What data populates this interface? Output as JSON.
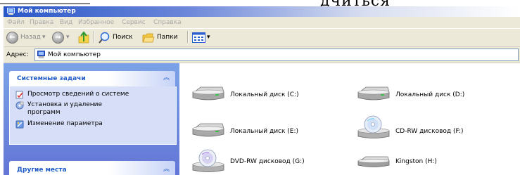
{
  "document": {
    "fragment_text": "дчиться"
  },
  "window": {
    "title": "Мой компьютер"
  },
  "menu": [
    "Файл",
    "Правка",
    "Вид",
    "Избранное",
    "Сервис",
    "Справка"
  ],
  "toolbar": {
    "back_label": "Назад",
    "search_label": "Поиск",
    "folders_label": "Папки"
  },
  "address": {
    "label": "Адрес:",
    "value": "Мой компьютер"
  },
  "left_pane": {
    "system_tasks": {
      "header": "Системные задачи",
      "items": [
        {
          "label": "Просмотр сведений о системе",
          "icon": "system-info-icon"
        },
        {
          "label": "Установка и удаление\nпрограмм",
          "icon": "add-remove-programs-icon"
        },
        {
          "label": "Изменение параметра",
          "icon": "control-panel-icon"
        }
      ]
    },
    "other_places": {
      "header": "Другие места"
    },
    "chevron": "⌃"
  },
  "drives": [
    {
      "label": "Локальный диск (C:)",
      "icon": "hard-disk-icon"
    },
    {
      "label": "Локальный диск (D:)",
      "icon": "hard-disk-icon"
    },
    {
      "label": "Локальный диск (E:)",
      "icon": "hard-disk-icon"
    },
    {
      "label": "CD-RW дисковод (F:)",
      "icon": "cd-drive-icon"
    },
    {
      "label": "DVD-RW дисковод (G:)",
      "icon": "dvd-drive-icon"
    },
    {
      "label": "Kingston (H:)",
      "icon": "removable-disk-icon"
    }
  ],
  "colors": {
    "title_bar_start": "#2a57c8",
    "task_pane": "#6375d6",
    "task_header_text": "#215dc6"
  }
}
